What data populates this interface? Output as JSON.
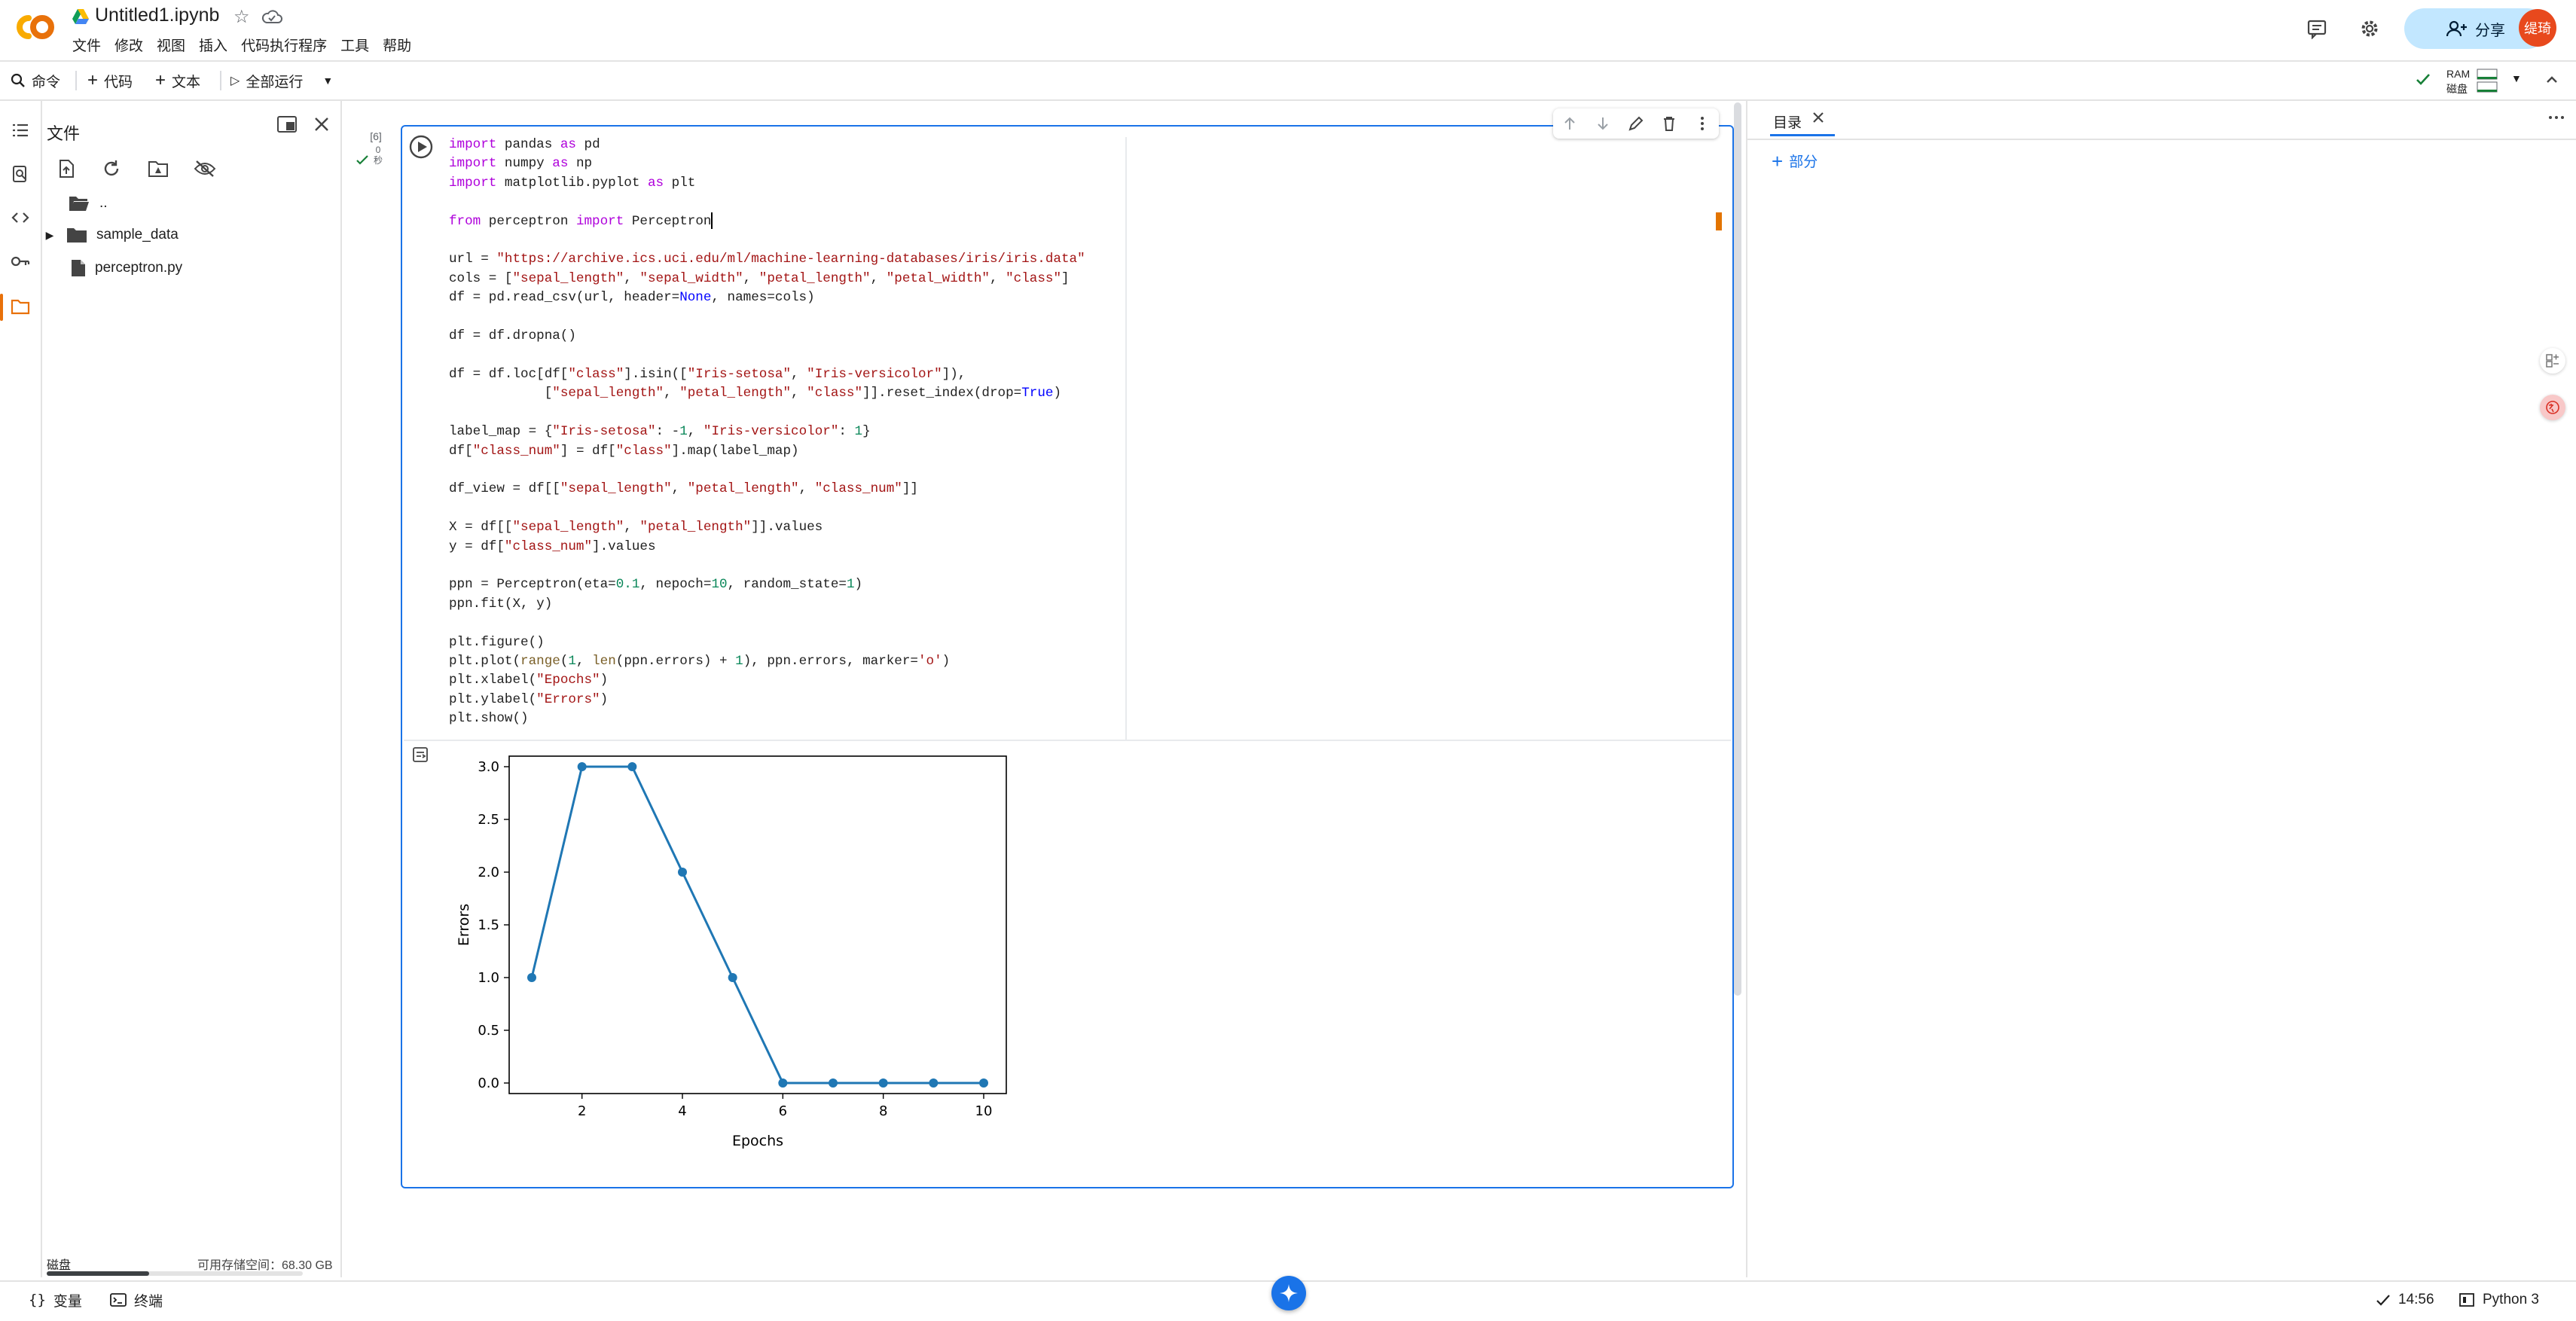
{
  "header": {
    "title": "Untitled1.ipynb",
    "menu": [
      "文件",
      "修改",
      "视图",
      "插入",
      "代码执行程序",
      "工具",
      "帮助"
    ],
    "share_label": "分享",
    "avatar_text": "缇琦"
  },
  "toolbar": {
    "command_label": "命令",
    "code_label": "代码",
    "text_label": "文本",
    "runall_label": "全部运行",
    "ram_label": "RAM",
    "disk_label": "磁盘"
  },
  "filepanel": {
    "title": "文件",
    "items": [
      {
        "name": "..",
        "icon": "folder-open-icon"
      },
      {
        "name": "sample_data",
        "icon": "folder-icon"
      },
      {
        "name": "perceptron.py",
        "icon": "file-icon"
      }
    ],
    "disk_label": "磁盘",
    "disk_available": "可用存储空间：68.30 GB",
    "disk_used_fraction": 0.4
  },
  "cell": {
    "exec_count": "[6]",
    "exec_time_value": "0",
    "exec_time_unit": "秒",
    "code_lines": [
      "import pandas as pd",
      "import numpy as np",
      "import matplotlib.pyplot as plt",
      "",
      "from perceptron import Perceptron",
      "",
      "url = \"https://archive.ics.uci.edu/ml/machine-learning-databases/iris/iris.data\"",
      "cols = [\"sepal_length\", \"sepal_width\", \"petal_length\", \"petal_width\", \"class\"]",
      "df = pd.read_csv(url, header=None, names=cols)",
      "",
      "df = df.dropna()",
      "",
      "df = df.loc[df[\"class\"].isin([\"Iris-setosa\", \"Iris-versicolor\"]),",
      "            [\"sepal_length\", \"petal_length\", \"class\"]].reset_index(drop=True)",
      "",
      "label_map = {\"Iris-setosa\": -1, \"Iris-versicolor\": 1}",
      "df[\"class_num\"] = df[\"class\"].map(label_map)",
      "",
      "df_view = df[[\"sepal_length\", \"petal_length\", \"class_num\"]]",
      "",
      "X = df[[\"sepal_length\", \"petal_length\"]].values",
      "y = df[\"class_num\"].values",
      "",
      "ppn = Perceptron(eta=0.1, nepoch=10, random_state=1)",
      "ppn.fit(X, y)",
      "",
      "plt.figure()",
      "plt.plot(range(1, len(ppn.errors) + 1), ppn.errors, marker='o')",
      "plt.xlabel(\"Epochs\")",
      "plt.ylabel(\"Errors\")",
      "plt.show()"
    ]
  },
  "chart_data": {
    "type": "line",
    "title": "",
    "xlabel": "Epochs",
    "ylabel": "Errors",
    "x": [
      1,
      2,
      3,
      4,
      5,
      6,
      7,
      8,
      9,
      10
    ],
    "series": [
      {
        "values": [
          1,
          3,
          3,
          2,
          1,
          0,
          0,
          0,
          0,
          0
        ],
        "color": "#1f77b4",
        "marker": "o"
      }
    ],
    "xlim": [
      0.55,
      10.45
    ],
    "ylim": [
      -0.1,
      3.1
    ],
    "xticks": [
      2,
      4,
      6,
      8,
      10
    ],
    "yticks": [
      0.0,
      0.5,
      1.0,
      1.5,
      2.0,
      2.5,
      3.0
    ],
    "xtick_labels": [
      "2",
      "4",
      "6",
      "8",
      "10"
    ],
    "ytick_labels": [
      "0.0",
      "0.5",
      "1.0",
      "1.5",
      "2.0",
      "2.5",
      "3.0"
    ],
    "grid": false
  },
  "toc": {
    "tab_label": "目录",
    "add_section_label": "部分"
  },
  "statusbar": {
    "variables_label": "变量",
    "terminal_label": "终端",
    "time": "14:56",
    "runtime": "Python 3"
  },
  "colors": {
    "accent": "#1a73e8",
    "share_bg": "#c2e7ff",
    "avatar_bg": "#e8491d",
    "line": "#1f77b4"
  }
}
